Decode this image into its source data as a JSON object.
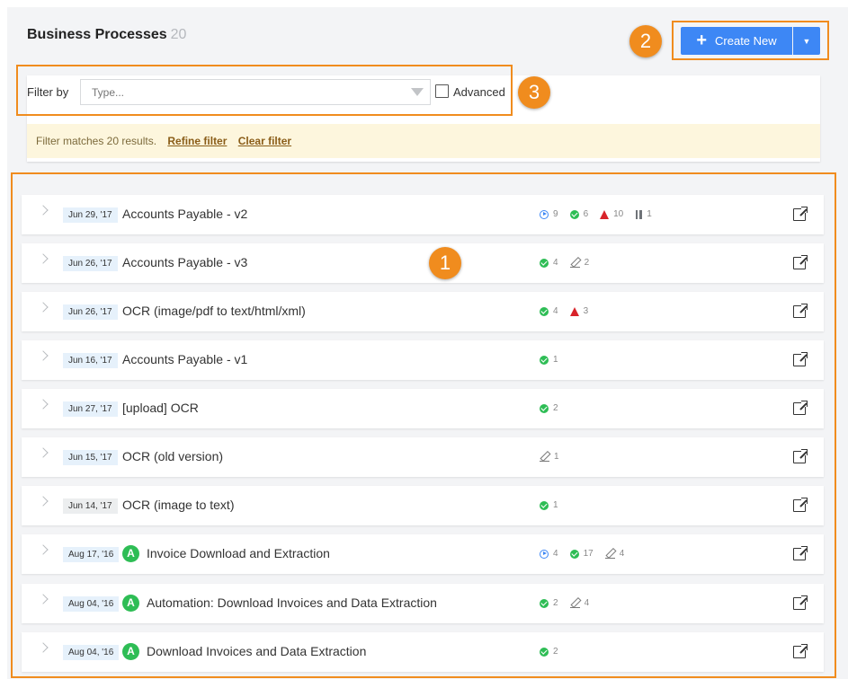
{
  "header": {
    "title": "Business Processes",
    "count": "20"
  },
  "actions": {
    "create_label": "Create New",
    "plus_glyph": "+",
    "dropdown_glyph": "▼"
  },
  "filter": {
    "label": "Filter by",
    "placeholder": "Type...",
    "advanced_label": "Advanced"
  },
  "notice": {
    "text": "Filter matches 20 results.",
    "refine": "Refine filter",
    "clear": "Clear filter"
  },
  "callouts": [
    "1",
    "2",
    "3"
  ],
  "rows": [
    {
      "date": "Jun 29, '17",
      "name": "Accounts Payable - v2",
      "automated": false,
      "stats": [
        {
          "icon": "running-icon",
          "value": "9"
        },
        {
          "icon": "success-icon",
          "value": "6"
        },
        {
          "icon": "error-icon",
          "value": "10"
        },
        {
          "icon": "paused-icon",
          "value": "1"
        }
      ]
    },
    {
      "date": "Jun 26, '17",
      "name": "Accounts Payable - v3",
      "automated": false,
      "stats": [
        {
          "icon": "success-icon",
          "value": "4"
        },
        {
          "icon": "draft-icon",
          "value": "2"
        }
      ]
    },
    {
      "date": "Jun 26, '17",
      "name": "OCR (image/pdf to text/html/xml)",
      "automated": false,
      "stats": [
        {
          "icon": "success-icon",
          "value": "4"
        },
        {
          "icon": "error-icon",
          "value": "3"
        }
      ]
    },
    {
      "date": "Jun 16, '17",
      "name": "Accounts Payable - v1",
      "automated": false,
      "stats": [
        {
          "icon": "success-icon",
          "value": "1"
        }
      ]
    },
    {
      "date": "Jun 27, '17",
      "name": "[upload] OCR",
      "automated": false,
      "stats": [
        {
          "icon": "success-icon",
          "value": "2"
        }
      ]
    },
    {
      "date": "Jun 15, '17",
      "name": "OCR (old version)",
      "automated": false,
      "stats": [
        {
          "icon": "draft-icon",
          "value": "1"
        }
      ]
    },
    {
      "date": "Jun 14, '17",
      "name": "OCR (image to text)",
      "automated": false,
      "grey": true,
      "stats": [
        {
          "icon": "success-icon",
          "value": "1"
        }
      ]
    },
    {
      "date": "Aug 17, '16",
      "name": "Invoice Download and Extraction",
      "automated": true,
      "stats": [
        {
          "icon": "running-icon",
          "value": "4"
        },
        {
          "icon": "success-icon",
          "value": "17"
        },
        {
          "icon": "draft-icon",
          "value": "4"
        }
      ]
    },
    {
      "date": "Aug 04, '16",
      "name": "Automation: Download Invoices and Data Extraction",
      "automated": true,
      "stats": [
        {
          "icon": "success-icon",
          "value": "2"
        },
        {
          "icon": "draft-icon",
          "value": "4"
        }
      ]
    },
    {
      "date": "Aug 04, '16",
      "name": "Download Invoices and Data Extraction",
      "automated": true,
      "stats": [
        {
          "icon": "success-icon",
          "value": "2"
        }
      ]
    }
  ],
  "automated_badge": "A",
  "colors": {
    "accent": "#3d87f5",
    "callout": "#f08c1e",
    "success": "#2ebd55",
    "error": "#d8232a",
    "notice_bg": "#fdf6dd"
  }
}
